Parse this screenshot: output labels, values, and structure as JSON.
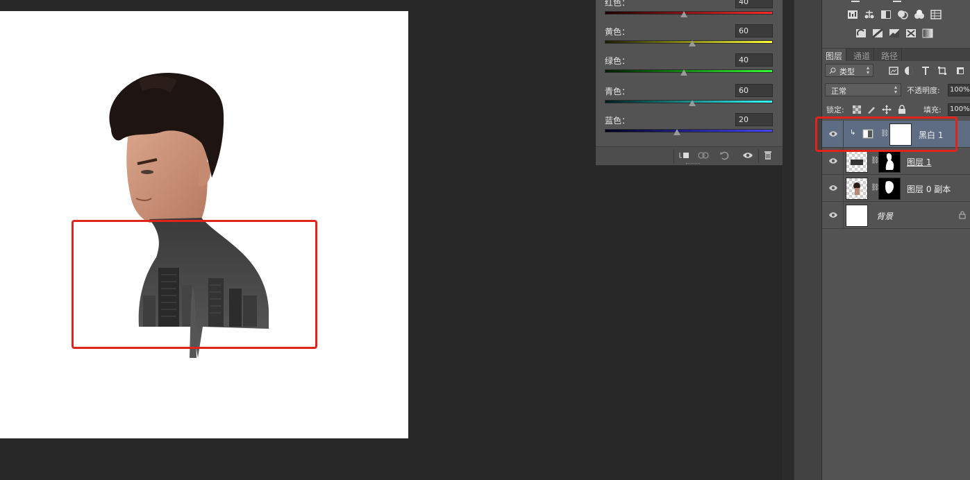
{
  "properties_panel": {
    "sliders": [
      {
        "label": "红色：",
        "value": "40",
        "position": 0.47,
        "color_start": "#1c0000",
        "color_end": "#ff2a2a"
      },
      {
        "label": "黄色：",
        "value": "60",
        "position": 0.52,
        "color_start": "#1c1c00",
        "color_end": "#ffff33"
      },
      {
        "label": "绿色：",
        "value": "40",
        "position": 0.47,
        "color_start": "#001c00",
        "color_end": "#33ff33"
      },
      {
        "label": "青色：",
        "value": "60",
        "position": 0.52,
        "color_start": "#001c1c",
        "color_end": "#33ffff"
      },
      {
        "label": "蓝色：",
        "value": "20",
        "position": 0.43,
        "color_start": "#00001c",
        "color_end": "#4444ff"
      }
    ]
  },
  "layers_panel": {
    "tabs": [
      {
        "label": "图层",
        "active": true
      },
      {
        "label": "通道",
        "active": false
      },
      {
        "label": "路径",
        "active": false
      }
    ],
    "filter_kind": "类型",
    "blend_mode": "正常",
    "opacity_label": "不透明度:",
    "opacity_value": "100%",
    "lock_label": "锁定:",
    "fill_label": "填充:",
    "fill_value": "100%",
    "layers": [
      {
        "name": "黑白 1",
        "type": "adjustment",
        "selected": true
      },
      {
        "name": "图层 1",
        "type": "masked",
        "selected": false
      },
      {
        "name": "图层 0 副本",
        "type": "masked",
        "selected": false
      },
      {
        "name": "背景",
        "type": "background",
        "selected": false
      }
    ]
  },
  "colors": {
    "highlight": "#e2231a",
    "selected_layer": "#5e6c84",
    "panel_bg": "#535353",
    "workspace_bg": "#282828"
  }
}
